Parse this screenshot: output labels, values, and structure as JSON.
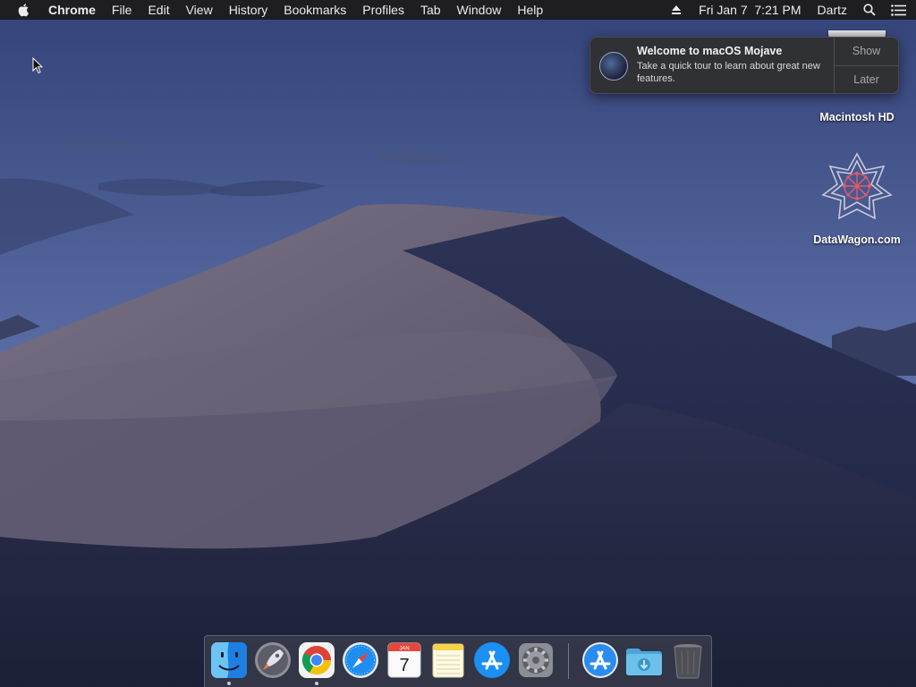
{
  "menubar": {
    "app_name": "Chrome",
    "menus": [
      "File",
      "Edit",
      "View",
      "History",
      "Bookmarks",
      "Profiles",
      "Tab",
      "Window",
      "Help"
    ],
    "datetime": "Fri Jan 7  7:21 PM",
    "user": "Dartz",
    "icons": [
      "apple-icon",
      "eject-icon",
      "spotlight-search-icon",
      "notification-center-icon"
    ]
  },
  "notification": {
    "title": "Welcome to macOS Mojave",
    "body": "Take a quick tour to learn about great new features.",
    "show_label": "Show",
    "later_label": "Later",
    "icon": "mojave-icon"
  },
  "desktop": {
    "icons": [
      {
        "label": "Macintosh HD",
        "icon": "hard-drive-icon"
      },
      {
        "label": "DataWagon.com",
        "icon": "datawagon-logo-icon"
      }
    ]
  },
  "calendar_icon": {
    "month": "JAN",
    "day": "7"
  },
  "dock": {
    "apps": [
      {
        "name": "Finder",
        "icon": "finder-icon",
        "running": true
      },
      {
        "name": "Launchpad",
        "icon": "launchpad-icon",
        "running": false
      },
      {
        "name": "Google Chrome",
        "icon": "chrome-icon",
        "running": true
      },
      {
        "name": "Safari",
        "icon": "safari-icon",
        "running": false
      },
      {
        "name": "Calendar",
        "icon": "calendar-icon",
        "running": false
      },
      {
        "name": "Notes",
        "icon": "notes-icon",
        "running": false
      },
      {
        "name": "App Store",
        "icon": "app-store-icon",
        "running": false
      },
      {
        "name": "System Preferences",
        "icon": "system-preferences-icon",
        "running": false
      }
    ],
    "others": [
      {
        "name": "Applications",
        "icon": "applications-folder-icon"
      },
      {
        "name": "Downloads",
        "icon": "downloads-folder-icon"
      },
      {
        "name": "Trash",
        "icon": "trash-icon"
      }
    ]
  },
  "colors": {
    "menubar_bg": "#1d1d22",
    "sky_top": "#3b4a7e",
    "sky_bottom": "#5d71a6",
    "dune_light": "#6e6779",
    "dune_shadow": "#242a47"
  }
}
